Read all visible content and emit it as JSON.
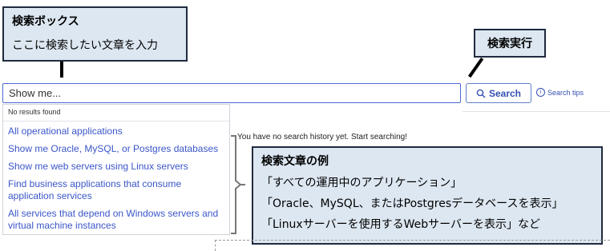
{
  "callouts": {
    "search_box": {
      "title": "検索ボックス",
      "body": "ここに検索したい文章を入力"
    },
    "execute": {
      "title": "検索実行"
    },
    "examples": {
      "title": "検索文章の例",
      "lines": [
        "「すべての運用中のアプリケーション」",
        "「Oracle、MySQL、またはPostgresデータベースを表示」",
        "「Linuxサーバーを使用するWebサーバーを表示」など"
      ]
    }
  },
  "search": {
    "placeholder": "Show me...",
    "button_label": "Search",
    "button_icon": "search-icon",
    "tips_label": "Search tips",
    "tips_icon": "info-icon"
  },
  "dropdown": {
    "no_results": "No results found",
    "suggestions": [
      "All operational applications",
      "Show me Oracle, MySQL, or Postgres databases",
      "Show me web servers using Linux servers",
      "Find business applications that consume application services",
      "All services that depend on Windows servers and virtual machine instances"
    ]
  },
  "history_message": "You have no search history yet. Start searching!",
  "colors": {
    "callout_bg": "#dde7f1",
    "callout_border": "#1f2b3f",
    "link": "#3b56c9",
    "input_border": "#4a6ad4"
  }
}
